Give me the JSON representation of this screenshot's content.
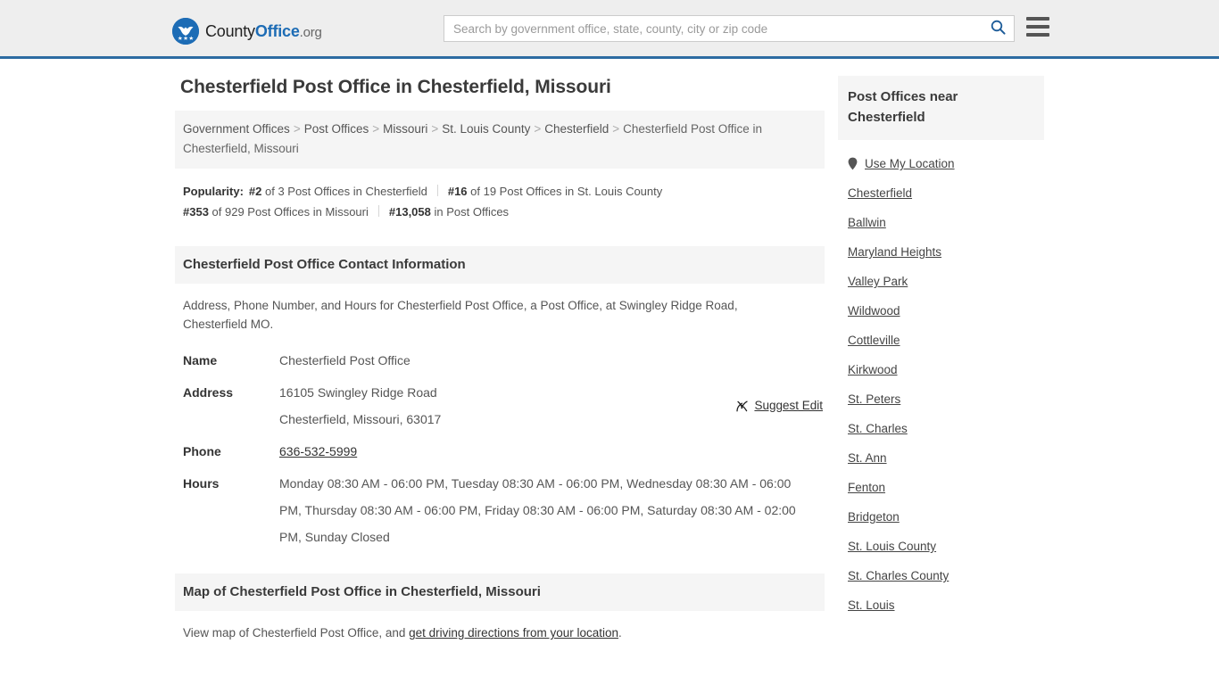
{
  "header": {
    "logo": {
      "icon": "eagle-shield-logo-icon",
      "part1": "County",
      "part2": "Office",
      "tld": ".org"
    },
    "search": {
      "placeholder": "Search by government office, state, county, city or zip code",
      "value": "",
      "search_icon": "search-icon"
    },
    "menu_icon": "hamburger-menu-icon",
    "accent_color": "#2d6ca2"
  },
  "main": {
    "page_title": "Chesterfield Post Office in Chesterfield, Missouri",
    "breadcrumb": {
      "items": [
        "Government Offices",
        "Post Offices",
        "Missouri",
        "St. Louis County",
        "Chesterfield"
      ],
      "current": "Chesterfield Post Office in Chesterfield, Missouri",
      "separator": ">"
    },
    "popularity": {
      "label": "Popularity:",
      "items": [
        {
          "rank": "#2",
          "text": "of 3 Post Offices in Chesterfield"
        },
        {
          "rank": "#16",
          "text": "of 19 Post Offices in St. Louis County"
        },
        {
          "rank": "#353",
          "text": "of 929 Post Offices in Missouri"
        },
        {
          "rank": "#13,058",
          "text": "in Post Offices"
        }
      ]
    },
    "contact": {
      "heading": "Chesterfield Post Office Contact Information",
      "description": "Address, Phone Number, and Hours for Chesterfield Post Office, a Post Office, at Swingley Ridge Road, Chesterfield MO.",
      "suggest_edit": {
        "label": "Suggest Edit",
        "icon": "edit-pencil-icon"
      },
      "rows": [
        {
          "key": "Name",
          "value": "Chesterfield Post Office",
          "link": false
        },
        {
          "key": "Address",
          "value": "16105 Swingley Ridge Road",
          "value2": "Chesterfield, Missouri, 63017",
          "link": false
        },
        {
          "key": "Phone",
          "value": "636-532-5999",
          "link": true
        },
        {
          "key": "Hours",
          "value": "Monday 08:30 AM - 06:00 PM, Tuesday 08:30 AM - 06:00 PM, Wednesday 08:30 AM - 06:00 PM, Thursday 08:30 AM - 06:00 PM, Friday 08:30 AM - 06:00 PM, Saturday 08:30 AM - 02:00 PM, Sunday Closed",
          "link": false
        }
      ]
    },
    "map": {
      "heading": "Map of Chesterfield Post Office in Chesterfield, Missouri",
      "desc_before": "View map of Chesterfield Post Office, and ",
      "desc_link": "get driving directions from your location",
      "desc_after": "."
    }
  },
  "sidebar": {
    "heading": "Post Offices near Chesterfield",
    "use_my_location": {
      "label": "Use My Location",
      "icon": "map-pin-icon"
    },
    "links": [
      "Chesterfield",
      "Ballwin",
      "Maryland Heights",
      "Valley Park",
      "Wildwood",
      "Cottleville",
      "Kirkwood",
      "St. Peters",
      "St. Charles",
      "St. Ann",
      "Fenton",
      "Bridgeton",
      "St. Louis County",
      "St. Charles County",
      "St. Louis"
    ]
  }
}
